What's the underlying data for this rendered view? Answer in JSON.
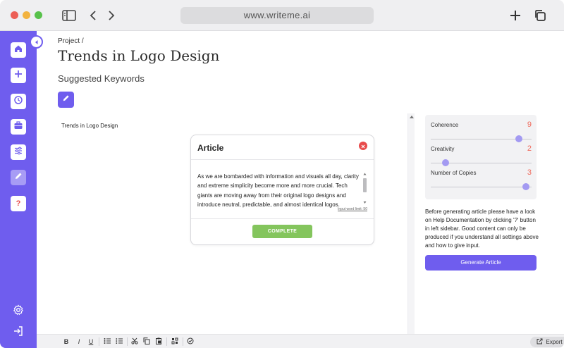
{
  "browser": {
    "url": "www.writeme.ai",
    "icons": [
      "sidebar-toggle-icon",
      "back-arrow-icon",
      "forward-arrow-icon",
      "new-tab-plus-icon",
      "tabs-overview-icon"
    ]
  },
  "sidebar": {
    "items": [
      {
        "name": "home",
        "icon": "home-icon"
      },
      {
        "name": "new",
        "icon": "plus-icon"
      },
      {
        "name": "history",
        "icon": "clock-icon"
      },
      {
        "name": "projects",
        "icon": "briefcase-icon"
      },
      {
        "name": "settings-sliders",
        "icon": "sliders-icon"
      },
      {
        "name": "edit",
        "icon": "pencil-icon",
        "active": true
      },
      {
        "name": "help",
        "icon": "question-icon",
        "label": "?"
      }
    ],
    "bottom_items": [
      {
        "name": "preferences",
        "icon": "gear-icon"
      },
      {
        "name": "logout",
        "icon": "logout-icon"
      }
    ],
    "accent": "#6f5dee"
  },
  "header": {
    "breadcrumb": "Project /",
    "title": "Trends in Logo Design",
    "subtitle": "Suggested Keywords"
  },
  "editor": {
    "heading": "Trends in Logo Design"
  },
  "dialog": {
    "title": "Article",
    "text": "As we are bombarded with information and visuals all day, clarity and extreme simplicity become more and more crucial. Tech giants are moving away from their original logo designs and introduce neutral, predictable, and almost identical logos.",
    "limit": "Input word limit: 50",
    "complete_label": "COMPLETE"
  },
  "settings": {
    "items": [
      {
        "label": "Coherence",
        "value": "9",
        "level": 0.9
      },
      {
        "label": "Creativity",
        "value": "2",
        "level": 0.12
      },
      {
        "label": "Number of Copies",
        "value": "3",
        "level": 0.98
      }
    ],
    "help_text": "Before generating article please have a look on Help Documentation by clicking '?' button in left sidebar. Good content can only be produced if you understand all settings above and how to give input.",
    "generate_label": "Generate Article"
  },
  "toolbar": {
    "items": [
      "bold",
      "italic",
      "underline",
      "bullet-list",
      "numbered-list",
      "cut",
      "copy",
      "paste",
      "word-count",
      "spell-check"
    ],
    "bold": "B",
    "italic": "I",
    "underline": "U",
    "export_label": "Export as PDF"
  }
}
